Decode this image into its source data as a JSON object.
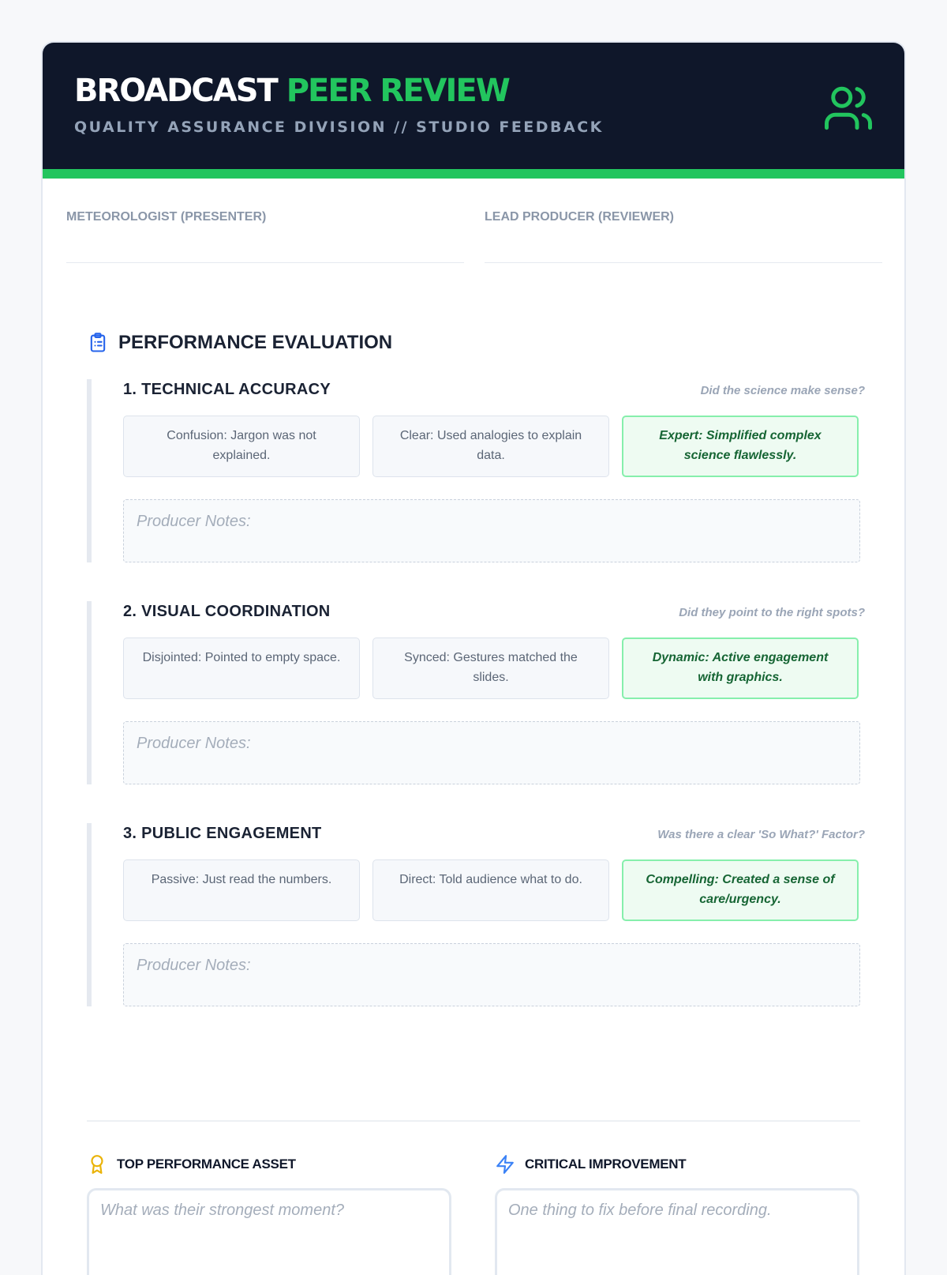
{
  "header": {
    "title_main": "BROADCAST",
    "title_accent": "PEER REVIEW",
    "subtitle": "QUALITY ASSURANCE DIVISION // STUDIO FEEDBACK",
    "icon": "users-icon"
  },
  "fields": {
    "presenter_label": "METEOROLOGIST (PRESENTER)",
    "reviewer_label": "LEAD PRODUCER (REVIEWER)"
  },
  "section": {
    "title": "PERFORMANCE EVALUATION",
    "icon": "clipboard-icon"
  },
  "criteria": [
    {
      "title": "1. TECHNICAL ACCURACY",
      "hint": "Did the science make sense?",
      "options": [
        "Confusion: Jargon was not explained.",
        "Clear: Used analogies to explain data.",
        "Expert: Simplified complex science flawlessly."
      ],
      "notes_placeholder": "Producer Notes:"
    },
    {
      "title": "2. VISUAL COORDINATION",
      "hint": "Did they point to the right spots?",
      "options": [
        "Disjointed: Pointed to empty space.",
        "Synced: Gestures matched the slides.",
        "Dynamic: Active engagement with graphics."
      ],
      "notes_placeholder": "Producer Notes:"
    },
    {
      "title": "3. PUBLIC ENGAGEMENT",
      "hint": "Was there a clear 'So What?' Factor?",
      "options": [
        "Passive: Just read the numbers.",
        "Direct: Told audience what to do.",
        "Compelling: Created a sense of care/urgency."
      ],
      "notes_placeholder": "Producer Notes:"
    }
  ],
  "summary": {
    "asset": {
      "label": "TOP PERFORMANCE ASSET",
      "placeholder": "What was their strongest moment?",
      "icon": "award-icon"
    },
    "improvement": {
      "label": "CRITICAL IMPROVEMENT",
      "placeholder": "One thing to fix before final recording.",
      "icon": "lightning-icon"
    }
  },
  "colors": {
    "header_bg": "#0f172a",
    "accent_green": "#22c55e",
    "selected_bg": "#eefbf2",
    "selected_text": "#166534",
    "award_icon": "#eab308",
    "lightning_icon": "#3b82f6",
    "clipboard_icon": "#2563eb"
  }
}
